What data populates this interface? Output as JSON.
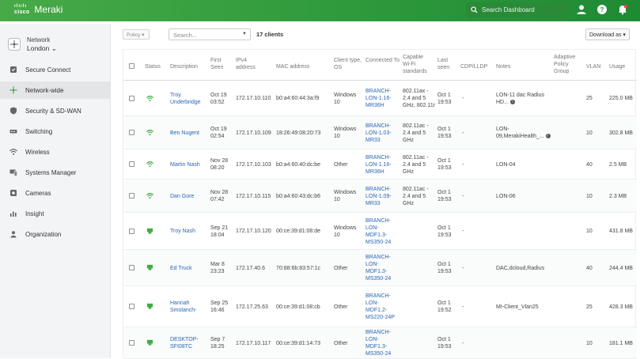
{
  "header": {
    "cisco_label": "cisco",
    "app_title": "Meraki",
    "search_placeholder": "Search Dashboard",
    "accent": "#2e9a3c"
  },
  "sidebar": {
    "network_label": "Network",
    "network_name": "London",
    "items": [
      {
        "label": "Secure Connect",
        "icon": "secure-connect-icon"
      },
      {
        "label": "Network-wide",
        "icon": "network-wide-icon",
        "active": true
      },
      {
        "label": "Security & SD-WAN",
        "icon": "shield-icon"
      },
      {
        "label": "Switching",
        "icon": "switch-icon"
      },
      {
        "label": "Wireless",
        "icon": "wifi-icon"
      },
      {
        "label": "Systems Manager",
        "icon": "systems-manager-icon"
      },
      {
        "label": "Cameras",
        "icon": "camera-icon"
      },
      {
        "label": "Insight",
        "icon": "insight-icon"
      },
      {
        "label": "Organization",
        "icon": "organization-icon"
      }
    ]
  },
  "toolbar": {
    "policy_label": "Policy ▾",
    "search_placeholder": "Search...",
    "client_count": "17 clients",
    "download_label": "Download as ▾"
  },
  "table": {
    "columns": {
      "status": "Status",
      "description": "Description",
      "first_seen": "First Seen",
      "ipv4": "IPv4 address",
      "mac": "MAC address",
      "client_type": "Client type, OS",
      "connected_to": "Connected To",
      "capable_wifi": "Capable Wi-Fi standards",
      "last_seen": "Last seen",
      "cdp_lldp": "CDP/LLDP",
      "notes": "Notes",
      "policy_group": "Adaptive Policy Group",
      "vlan": "VLAN",
      "usage": "Usage"
    },
    "rows": [
      {
        "status": "wireless",
        "description": "Troy Underbridge",
        "first_seen": "Oct 19 03:52",
        "ipv4": "172.17.10.110",
        "mac": "b0:a4:60:44:3a:f9",
        "client_type": "Windows 10",
        "connected_to": "BRANCH-LON-1.16-MR36H",
        "wifi": "802.11ax - 2.4 and 5 GHz, 802.11r",
        "last_seen": "Oct 1 19:53",
        "cdp": "-",
        "notes": "LON-11 dac Radius HD...",
        "notes_info": true,
        "policy": "",
        "vlan": "25",
        "usage": "225.0 MB"
      },
      {
        "status": "wireless",
        "description": "Ben Nugent",
        "first_seen": "Oct 19 02:54",
        "ipv4": "172.17.10.109",
        "mac": "18:26:49:08:20:73",
        "client_type": "Windows 10",
        "connected_to": "BRANCH-LON-1.03-MR33",
        "wifi": "802.11ac - 2.4 and 5 GHz",
        "last_seen": "Oct 1 19:53",
        "cdp": "-",
        "notes": "LON-09,MerakiHealth_...",
        "notes_info": true,
        "policy": "",
        "vlan": "10",
        "usage": "302.8 MB"
      },
      {
        "status": "wireless",
        "description": "Martin Nash",
        "first_seen": "Nov 28 08:20",
        "ipv4": "172.17.10.103",
        "mac": "b0:a4:60:40:dc:be",
        "client_type": "Other",
        "connected_to": "BRANCH-LON-1.16-MR36H",
        "wifi": "802.11ac - 2.4 and 5 GHz",
        "last_seen": "Oct 1 19:53",
        "cdp": "-",
        "notes": "LON-04",
        "notes_info": false,
        "policy": "",
        "vlan": "40",
        "usage": "2.5 MB"
      },
      {
        "status": "wireless",
        "description": "Dan Gore",
        "first_seen": "Nov 28 07:42",
        "ipv4": "172.17.10.115",
        "mac": "b0:a4:60:43:dc:b6",
        "client_type": "Windows 10",
        "connected_to": "BRANCH-LON-1.09-MR33",
        "wifi": "802.11ac - 2.4 and 5 GHz",
        "last_seen": "Oct 1 19:53",
        "cdp": "-",
        "notes": "LON-06",
        "notes_info": false,
        "policy": "",
        "vlan": "10",
        "usage": "2.3 MB"
      },
      {
        "status": "wired",
        "description": "Troy Nash",
        "first_seen": "Sep 21 18:04",
        "ipv4": "172.17.10.120",
        "mac": "00:ce:39:d1:08:de",
        "client_type": "Windows 10",
        "connected_to": "BRANCH-LON-MDF1.3-MS350-24",
        "wifi": "",
        "last_seen": "Oct 1 19:53",
        "cdp": "-",
        "notes": "",
        "notes_info": false,
        "policy": "",
        "vlan": "10",
        "usage": "431.8 MB"
      },
      {
        "status": "wired",
        "description": "Ed Truck",
        "first_seen": "Mar 8 23:23",
        "ipv4": "172.17.40.6",
        "mac": "70:88:6b:83:57:1c",
        "client_type": "Other",
        "connected_to": "BRANCH-LON-MDF1.3-MS350-24",
        "wifi": "",
        "last_seen": "Oct 1 19:53",
        "cdp": "-",
        "notes": "DAC,dcloud,Radius",
        "notes_info": false,
        "policy": "",
        "vlan": "40",
        "usage": "244.4 MB"
      },
      {
        "status": "wired",
        "description": "Hannah Smolanch-",
        "first_seen": "Sep 25 16:46",
        "ipv4": "172.17.25.63",
        "mac": "00:ce:39:d1:08:cb",
        "client_type": "Other",
        "connected_to": "BRANCH-LON-MDF1.2-MS220-24P",
        "wifi": "",
        "last_seen": "Oct 1 19:52",
        "cdp": "-",
        "notes": "MI-Client_Vlan25",
        "notes_info": false,
        "policy": "",
        "vlan": "25",
        "usage": "428.3 MB"
      },
      {
        "status": "wired",
        "description": "DESKTOP-SFI08TC",
        "first_seen": "Sep 7 18:25",
        "ipv4": "172.17.10.117",
        "mac": "00:ce:39:d1:14:73",
        "client_type": "Other",
        "connected_to": "BRANCH-LON-MDF1.3-MS350-24",
        "wifi": "",
        "last_seen": "Oct 1 19:53",
        "cdp": "-",
        "notes": "",
        "notes_info": false,
        "policy": "",
        "vlan": "10",
        "usage": "181.1 MB"
      }
    ]
  }
}
